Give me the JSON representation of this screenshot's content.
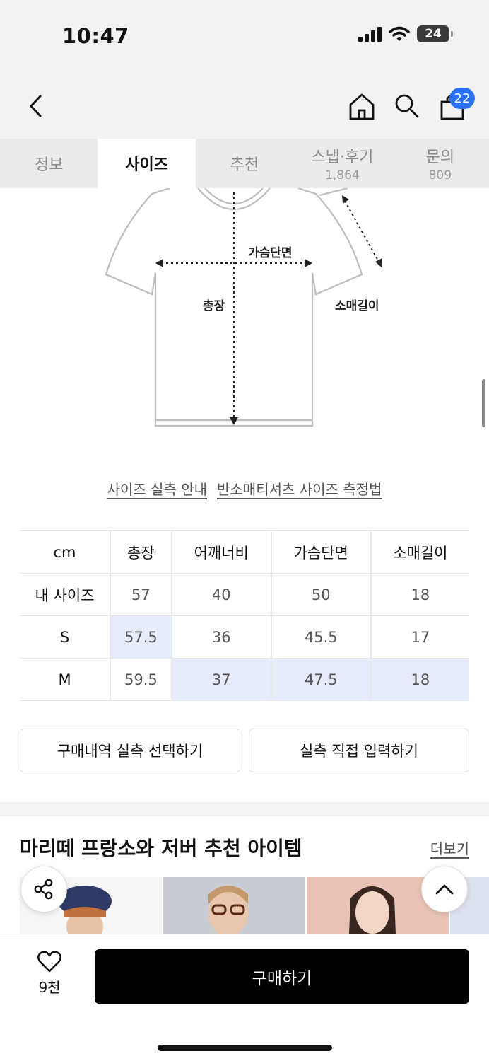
{
  "status_bar": {
    "time": "10:47",
    "battery": "24"
  },
  "header": {
    "cart_count": "22"
  },
  "tabs": [
    {
      "label": "정보",
      "count": ""
    },
    {
      "label": "사이즈",
      "count": ""
    },
    {
      "label": "추천",
      "count": ""
    },
    {
      "label": "스냅·후기",
      "count": "1,864"
    },
    {
      "label": "문의",
      "count": "809"
    }
  ],
  "active_tab": "사이즈",
  "diagram": {
    "chest_label": "가슴단면",
    "length_label": "총장",
    "sleeve_label": "소매길이"
  },
  "size_links": {
    "guide": "사이즈 실측 안내",
    "method": "반소매티셔츠 사이즈 측정법"
  },
  "size_table": {
    "headers": [
      "cm",
      "총장",
      "어깨너비",
      "가슴단면",
      "소매길이"
    ],
    "rows": [
      {
        "label": "내 사이즈",
        "values": [
          "57",
          "40",
          "50",
          "18"
        ]
      },
      {
        "label": "S",
        "values": [
          "57.5",
          "36",
          "45.5",
          "17"
        ]
      },
      {
        "label": "M",
        "values": [
          "59.5",
          "37",
          "47.5",
          "18"
        ]
      }
    ],
    "highlight_color": "#e6ecfb"
  },
  "actions": {
    "select_history": "구매내역 실측 선택하기",
    "direct_input": "실측 직접 입력하기"
  },
  "recommend": {
    "title": "마리떼 프랑소와 저버 추천 아이템",
    "more": "더보기"
  },
  "bottom": {
    "like_count": "9천",
    "buy_label": "구매하기"
  },
  "colors": {
    "accent_badge": "#2b6ff5",
    "buy_button": "#000000"
  }
}
